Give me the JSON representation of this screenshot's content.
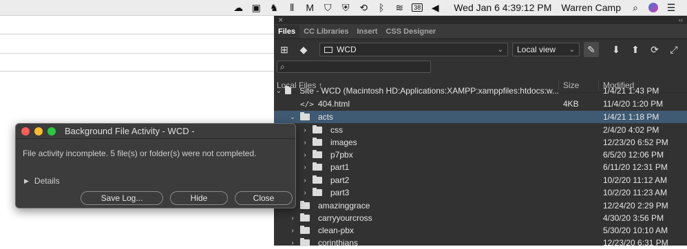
{
  "menubar": {
    "user": "Warren Camp",
    "clock": "Wed Jan 6  4:39:12 PM",
    "battery": "38"
  },
  "panel": {
    "tabs": [
      "Files",
      "CC Libraries",
      "Insert",
      "CSS Designer"
    ],
    "site_select": "WCD",
    "view_select": "Local view",
    "columns": {
      "local_files": "Local Files",
      "size": "Size",
      "modified": "Modified"
    },
    "rows": [
      {
        "name": "Site - WCD (Macintosh HD:Applications:XAMPP:xamppfiles:htdocs:w...",
        "size": "",
        "modified": "1/4/21 1:43 PM"
      },
      {
        "name": "404.html",
        "size": "4KB",
        "modified": "11/4/20 1:20 PM"
      },
      {
        "name": "acts",
        "size": "",
        "modified": "1/4/21 1:18 PM"
      },
      {
        "name": "css",
        "size": "",
        "modified": "2/4/20 4:02 PM"
      },
      {
        "name": "images",
        "size": "",
        "modified": "12/23/20 6:52 PM"
      },
      {
        "name": "p7pbx",
        "size": "",
        "modified": "6/5/20 12:06 PM"
      },
      {
        "name": "part1",
        "size": "",
        "modified": "6/11/20 12:31 PM"
      },
      {
        "name": "part2",
        "size": "",
        "modified": "10/2/20 11:12 AM"
      },
      {
        "name": "part3",
        "size": "",
        "modified": "10/2/20 11:23 AM"
      },
      {
        "name": "amazinggrace",
        "size": "",
        "modified": "12/24/20 2:29 PM"
      },
      {
        "name": "carryyourcross",
        "size": "",
        "modified": "4/30/20 3:56 PM"
      },
      {
        "name": "clean-pbx",
        "size": "",
        "modified": "5/30/20 10:10 AM"
      },
      {
        "name": "corinthians",
        "size": "",
        "modified": "12/23/20 6:31 PM"
      }
    ]
  },
  "dialog": {
    "title": "Background File Activity - WCD -",
    "message": "File activity incomplete. 5 file(s) or folder(s) were not completed.",
    "details": "Details",
    "buttons": {
      "save_log": "Save Log...",
      "hide": "Hide",
      "close": "Close"
    }
  },
  "colors": {
    "panel_bg": "#323232",
    "selected_row": "#3f5a73",
    "close_light": "#ff5f57",
    "min_light": "#febc2e",
    "max_light": "#28c840"
  }
}
